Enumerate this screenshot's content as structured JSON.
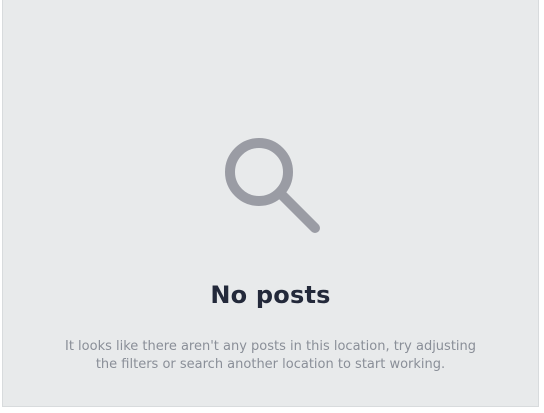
{
  "empty_state": {
    "icon": "search-icon",
    "title": "No posts",
    "message": "It looks like there aren't any posts in this location, try adjusting the filters or search another location to start working."
  },
  "colors": {
    "background": "#e8eaeb",
    "icon": "#9a9ca4",
    "title": "#23293a",
    "message": "#8a8f98"
  }
}
